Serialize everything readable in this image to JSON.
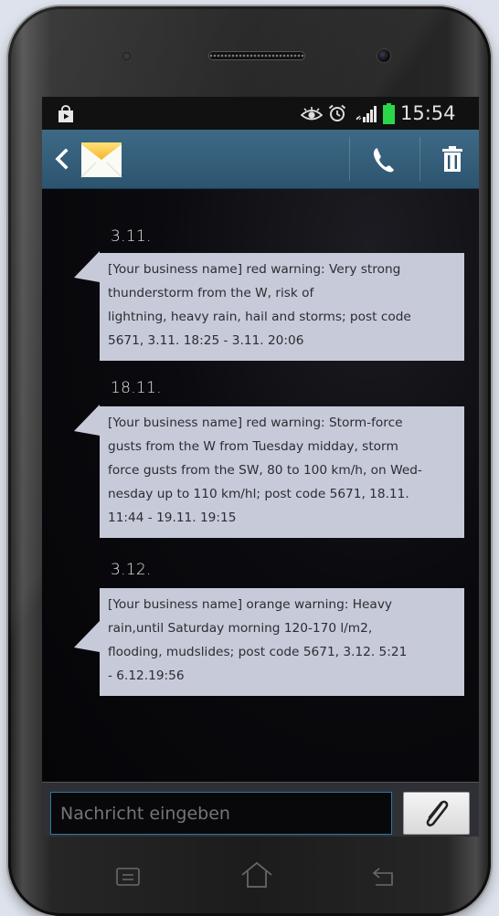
{
  "status_bar": {
    "time": "15:54",
    "icons": [
      "store-icon",
      "eye-icon",
      "alarm-icon",
      "signal-icon",
      "battery-icon"
    ]
  },
  "action_bar": {
    "icons": [
      "back-chevron-icon",
      "envelope-icon",
      "phone-icon",
      "trash-icon"
    ]
  },
  "messages": [
    {
      "date": "3.11.",
      "lines": [
        "[Your business name] red warning: Very  strong",
        "thunderstorm from the W, risk of",
        "lightning, heavy rain, hail and storms; post code",
        "5671, 3.11. 18:25 - 3.11. 20:06"
      ]
    },
    {
      "date": "18.11.",
      "lines": [
        "[Your business name] red warning: Storm-force",
        "gusts from the W from Tuesday midday, storm",
        "force gusts from the SW, 80 to 100 km/h, on Wed-",
        "nesday up to 110 km/hl; post code 5671, 18.11.",
        "11:44 - 19.11. 19:15"
      ]
    },
    {
      "date": "3.12.",
      "lines": [
        "[Your business name] orange warning: Heavy",
        "rain,until Saturday morning 120-170  l/m2,",
        "flooding, mudslides; post code 5671, 3.12. 5:21",
        "- 6.12.19:56"
      ]
    }
  ],
  "composer": {
    "placeholder": "Nachricht eingeben",
    "attach_icon": "paperclip-icon"
  },
  "nav_keys": [
    "menu-icon",
    "home-icon",
    "back-icon"
  ],
  "colors": {
    "action_bar": "#2c546f",
    "bubble": "#c7cad8",
    "input_border": "#2a7aa0",
    "battery": "#2bd64a"
  }
}
